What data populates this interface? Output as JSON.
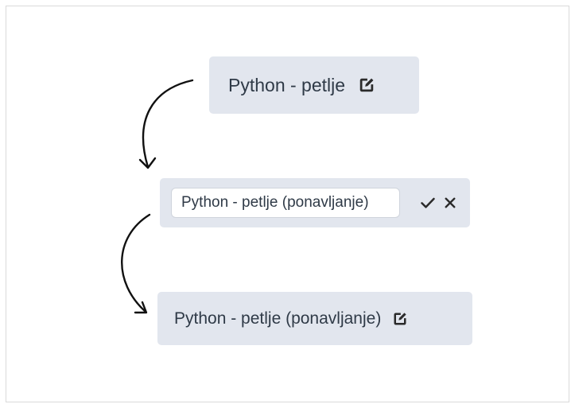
{
  "steps": {
    "view_title": "Python - petlje",
    "edit_input_value": "Python - petlje (ponavljanje)",
    "saved_title": "Python - petlje (ponavljanje)"
  },
  "icons": {
    "edit": "edit-icon",
    "confirm": "check-icon",
    "cancel": "close-icon",
    "flow_arrow": "curved-arrow-icon"
  },
  "colors": {
    "chip_background": "#e2e6ee",
    "text": "#2f3a47",
    "arrow": "#111111"
  }
}
